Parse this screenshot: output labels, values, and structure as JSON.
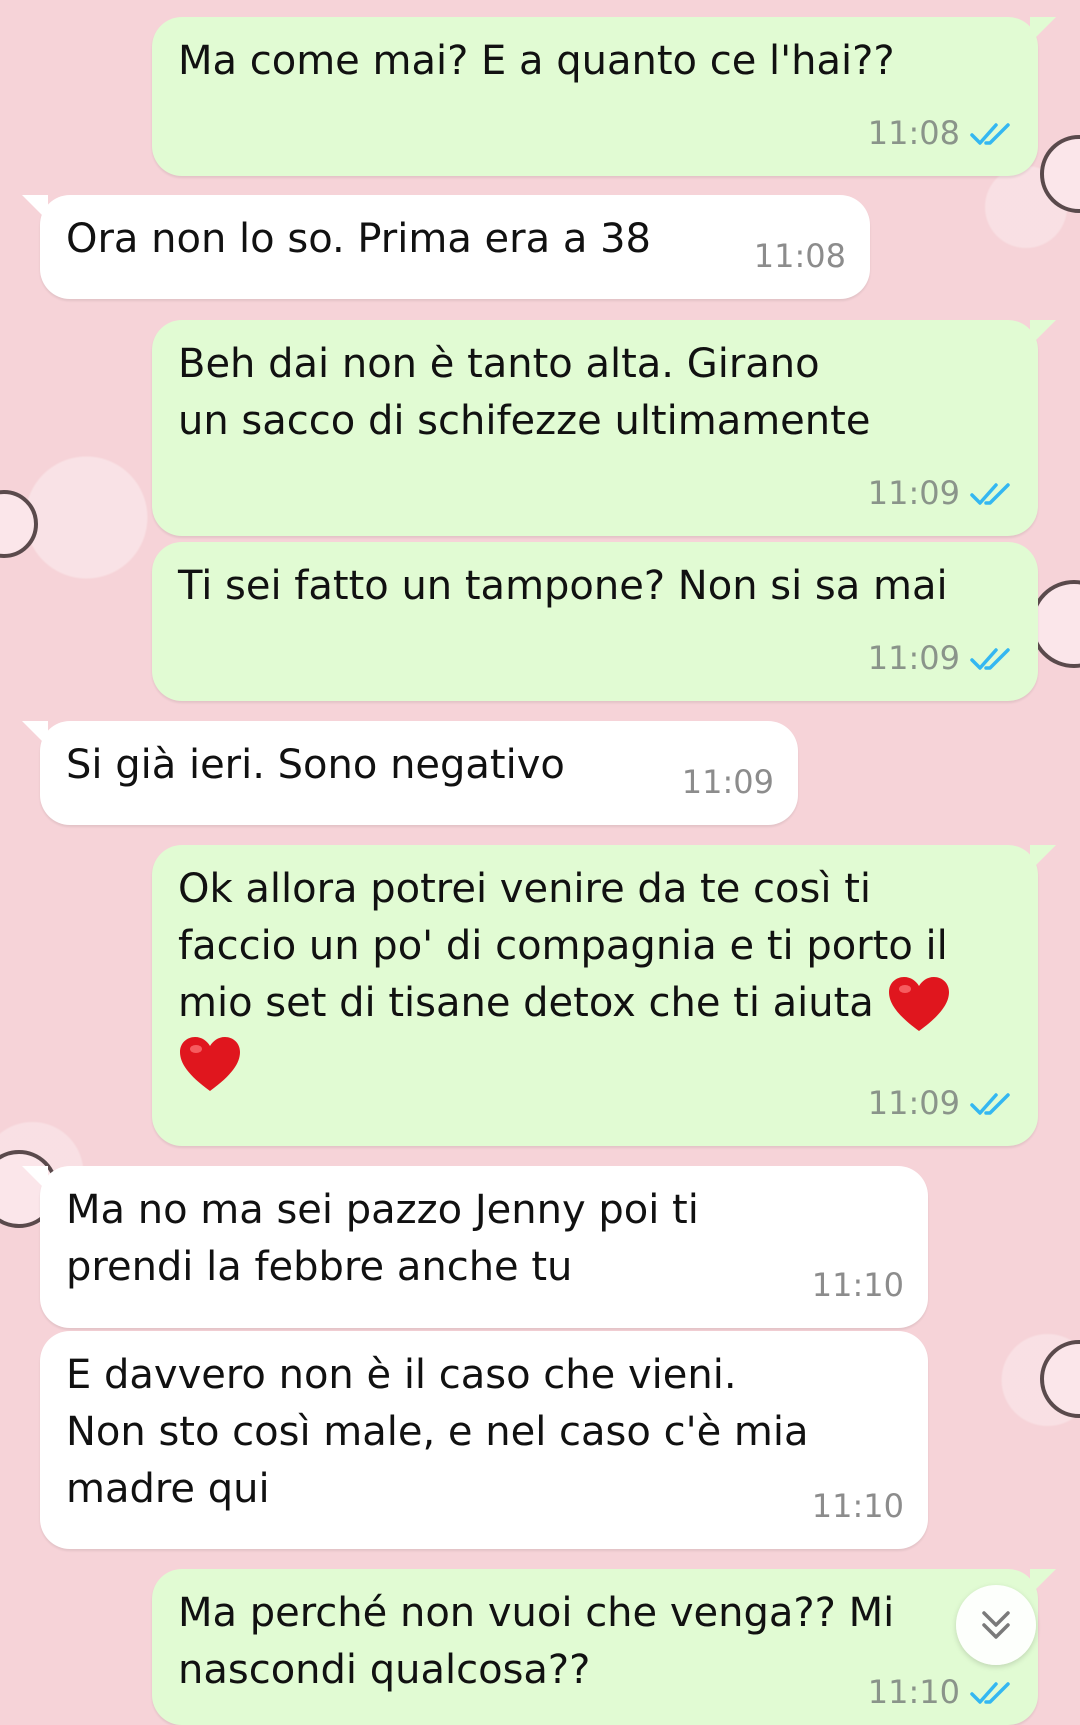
{
  "messages": [
    {
      "id": "m1",
      "direction": "outgoing",
      "text": "Ma come mai? E a quanto ce l'hai??",
      "time": "11:08",
      "status": "read"
    },
    {
      "id": "m2",
      "direction": "incoming",
      "text": "Ora non lo so. Prima era a 38",
      "time": "11:08"
    },
    {
      "id": "m3",
      "direction": "outgoing",
      "text": "Beh dai non è tanto alta. Girano\nun sacco di schifezze ultimamente",
      "time": "11:09",
      "status": "read"
    },
    {
      "id": "m4",
      "direction": "outgoing",
      "text": "Ti sei fatto un tampone? Non si sa mai",
      "time": "11:09",
      "status": "read"
    },
    {
      "id": "m5",
      "direction": "incoming",
      "text": "Si già ieri. Sono negativo",
      "time": "11:09"
    },
    {
      "id": "m6",
      "direction": "outgoing",
      "text": "Ok allora potrei venire da te così ti\nfaccio un po' di compagnia e ti porto il\nmio set di tisane detox che ti aiuta",
      "time": "11:09",
      "status": "read",
      "emoji": [
        "red-heart",
        "red-heart"
      ]
    },
    {
      "id": "m7",
      "direction": "incoming",
      "text": "Ma no ma sei pazzo Jenny poi ti\nprendi la febbre anche tu",
      "time": "11:10"
    },
    {
      "id": "m8",
      "direction": "incoming",
      "text": "E davvero non è il caso che vieni.\nNon sto così male, e nel caso c'è mia\nmadre qui",
      "time": "11:10"
    },
    {
      "id": "m9",
      "direction": "outgoing",
      "text": "Ma perché non vuoi che venga?? Mi\nnascondi qualcosa??",
      "time": "11:10",
      "status": "read"
    }
  ],
  "colors": {
    "outgoing_bubble": "#e1fbd3",
    "incoming_bubble": "#ffffff",
    "read_ticks": "#34b7f1",
    "wallpaper": "#f6d3d8"
  },
  "icons": {
    "read_receipt": "double-check-icon",
    "scroll_down": "chevron-double-down-icon",
    "heart": "red-heart-emoji"
  }
}
